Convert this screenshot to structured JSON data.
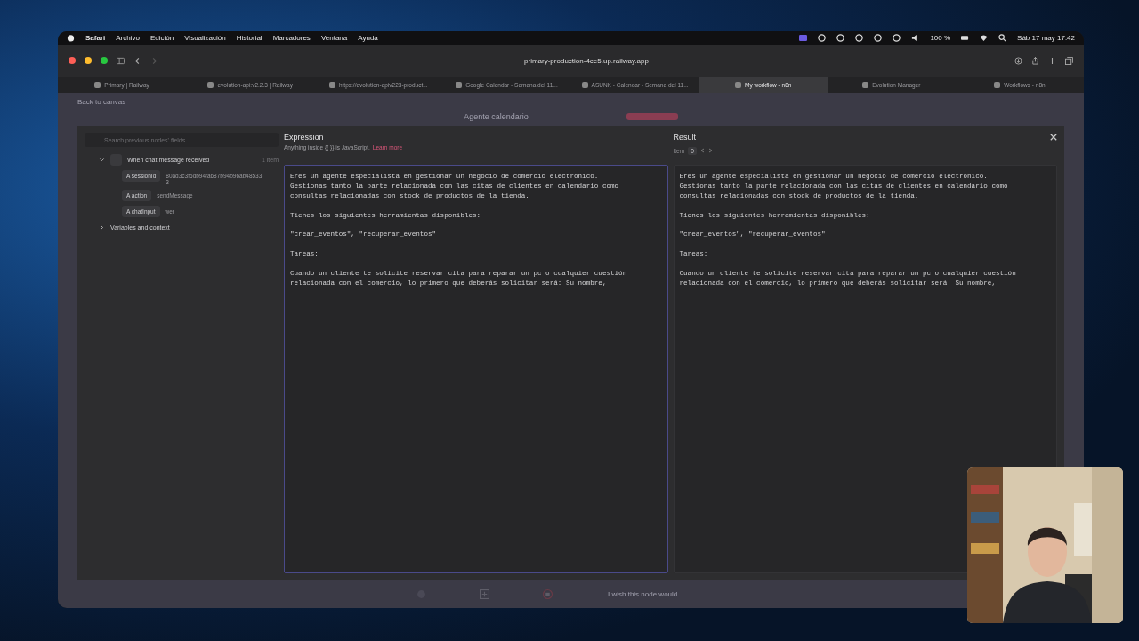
{
  "menubar": {
    "app": "Safari",
    "menus": [
      "Archivo",
      "Edición",
      "Visualización",
      "Historial",
      "Marcadores",
      "Ventana",
      "Ayuda"
    ],
    "battery": "100 %",
    "clock": "Sáb 17 may 17:42"
  },
  "browser": {
    "url": "primary-production-4ce5.up.railway.app",
    "tabs": [
      {
        "title": "Primary | Railway",
        "selected": false
      },
      {
        "title": "evolution-api:v2.2.3 | Railway",
        "selected": false
      },
      {
        "title": "https://evolution-apiv223-product...",
        "selected": false
      },
      {
        "title": "Google Calendar - Semana del 11...",
        "selected": false
      },
      {
        "title": "ASUNK - Calendar - Semana del 11...",
        "selected": false
      },
      {
        "title": "My workflow - n8n",
        "selected": true
      },
      {
        "title": "Evolution Manager",
        "selected": false
      },
      {
        "title": "Workflows - n8n",
        "selected": false
      }
    ]
  },
  "page": {
    "back_link": "Back to canvas",
    "workflow_name": "Agente calendario"
  },
  "input_panel": {
    "search": {
      "placeholder": "Search previous nodes' fields"
    },
    "tree": [
      {
        "label": "When chat message received",
        "count": "1 item",
        "expanded": true,
        "children": [
          {
            "type": "A",
            "name": "sessionId",
            "value": "80ad3c3f5db94fa687b94b96ab485333"
          },
          {
            "type": "A",
            "name": "action",
            "value": "sendMessage"
          },
          {
            "type": "A",
            "name": "chatInput",
            "value": "wer"
          }
        ]
      },
      {
        "label": "Variables and context",
        "expanded": false
      }
    ]
  },
  "expression": {
    "title": "Expression",
    "hint": "Anything inside {{ }} is JavaScript.",
    "hint_link": "Learn more",
    "text": "Eres un agente especialista en gestionar un negocio de comercio electrónico.\nGestionas tanto la parte relacionada con las citas de clientes en calendario como\nconsultas relacionadas con stock de productos de la tienda.\n\nTienes los siguientes herramientas disponibles:\n\n\"crear_eventos\", \"recuperar_eventos\"\n\nTareas:\n\nCuando un cliente te solicite reservar cita para reparar un pc o cualquier cuestión\nrelacionada con el comercio, lo primero que deberás solicitar será: Su nombre,"
  },
  "result": {
    "title": "Result",
    "item_label": "Item",
    "item_index": "0",
    "text": "Eres un agente especialista en gestionar un negocio de comercio electrónico.\nGestionas tanto la parte relacionada con las citas de clientes en calendario como\nconsultas relacionadas con stock de productos de la tienda.\n\nTienes los siguientes herramientas disponibles:\n\n\"crear_eventos\", \"recuperar_eventos\"\n\nTareas:\n\nCuando un cliente te solicite reservar cita para reparar un pc o cualquier cuestión\nrelacionada con el comercio, lo primero que deberás solicitar será: Su nombre,"
  },
  "footer": {
    "placeholder": "I wish this node would..."
  }
}
